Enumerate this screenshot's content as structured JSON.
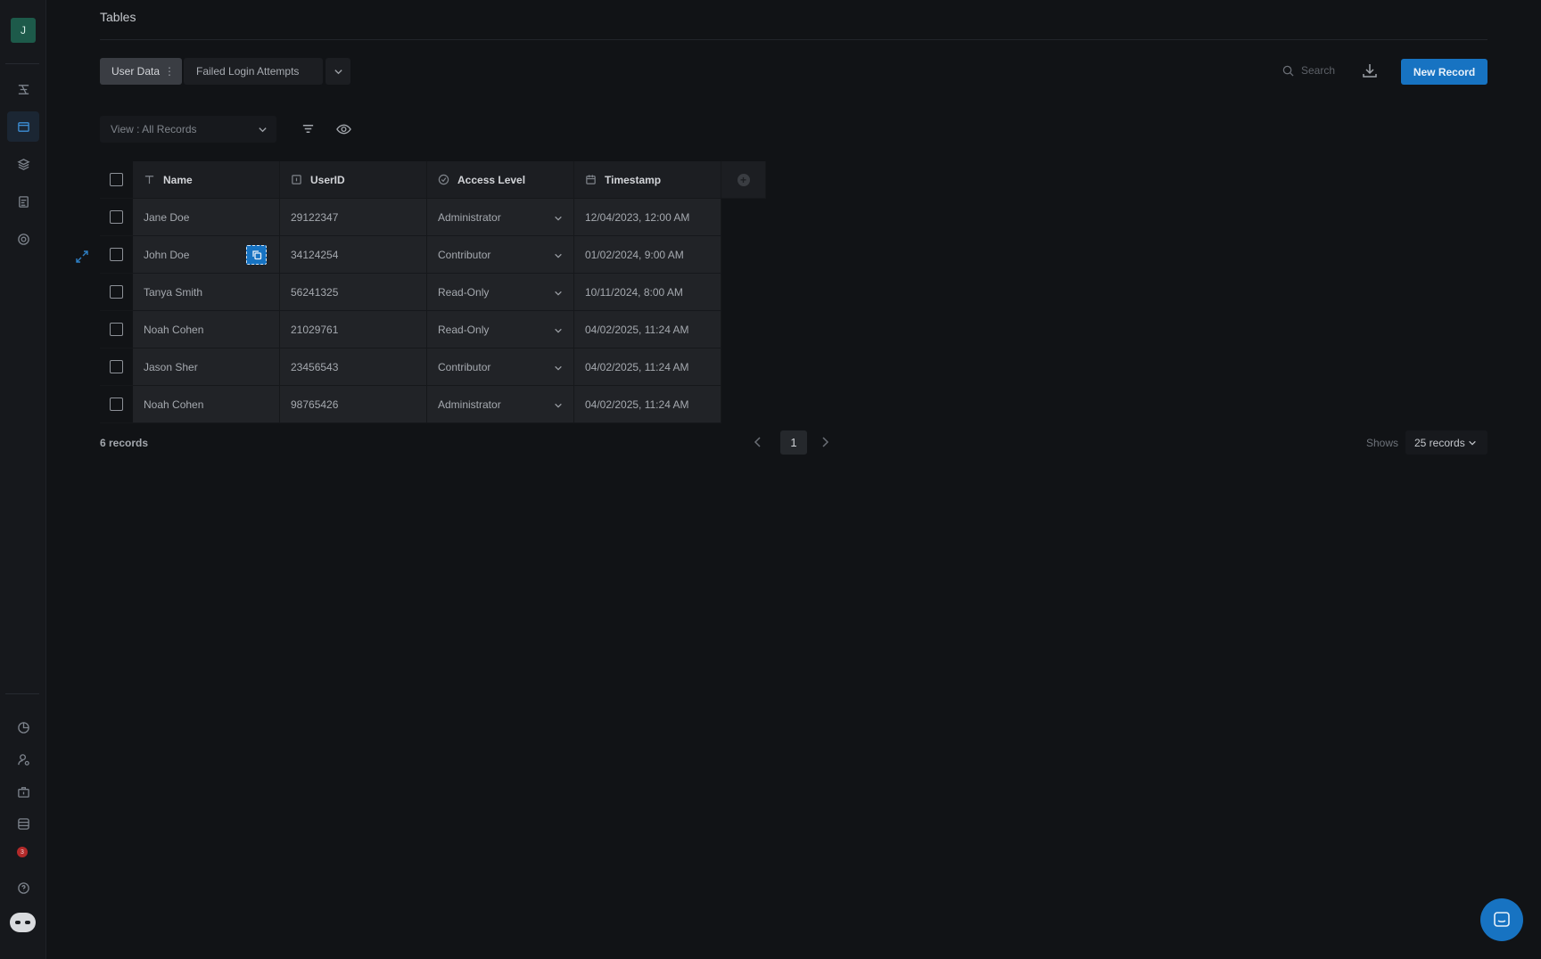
{
  "sidebar": {
    "avatar_initial": "J",
    "top_icons": [
      "settings-sliders-icon",
      "table-icon",
      "layers-icon",
      "clipboard-icon",
      "target-icon"
    ],
    "bottom_icons": [
      "pie-chart-icon",
      "user-settings-icon",
      "briefcase-icon",
      "database-icon",
      "notification-badge-icon",
      "help-icon",
      "bot-icon"
    ],
    "notification_count": "3"
  },
  "header": {
    "title": "Tables"
  },
  "tabs": [
    {
      "label": "User Data",
      "active": true
    },
    {
      "label": "Failed Login Attempts",
      "active": false
    }
  ],
  "toolbar": {
    "search_placeholder": "Search",
    "new_record_label": "New Record"
  },
  "view": {
    "label": "View : All Records"
  },
  "table": {
    "columns": [
      "Name",
      "UserID",
      "Access Level",
      "Timestamp"
    ],
    "rows": [
      {
        "name": "Jane Doe",
        "userid": "29122347",
        "access": "Administrator",
        "timestamp": "12/04/2023, 12:00 AM"
      },
      {
        "name": "John Doe",
        "userid": "34124254",
        "access": "Contributor",
        "timestamp": "01/02/2024, 9:00 AM"
      },
      {
        "name": "Tanya Smith",
        "userid": "56241325",
        "access": "Read-Only",
        "timestamp": "10/11/2024, 8:00 AM"
      },
      {
        "name": "Noah Cohen",
        "userid": "21029761",
        "access": "Read-Only",
        "timestamp": "04/02/2025, 11:24 AM"
      },
      {
        "name": "Jason Sher",
        "userid": "23456543",
        "access": "Contributor",
        "timestamp": "04/02/2025, 11:24 AM"
      },
      {
        "name": "Noah Cohen",
        "userid": "98765426",
        "access": "Administrator",
        "timestamp": "04/02/2025, 11:24 AM"
      }
    ]
  },
  "footer": {
    "record_count": "6 records",
    "current_page": "1",
    "shows_label": "Shows",
    "per_page": "25 records"
  },
  "colors": {
    "accent": "#1773c2",
    "background": "#111316"
  }
}
